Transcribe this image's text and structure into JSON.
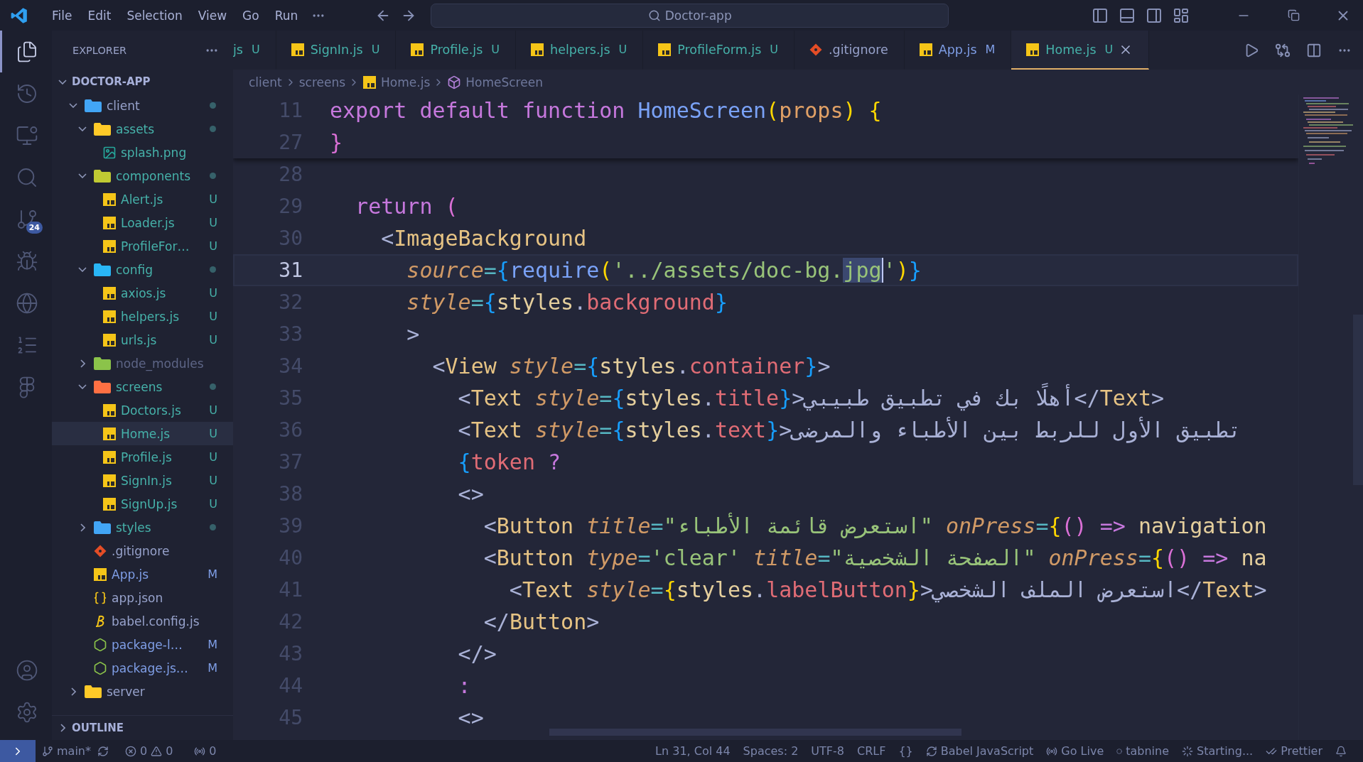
{
  "title_bar": {
    "menus": [
      "File",
      "Edit",
      "Selection",
      "View",
      "Go",
      "Run"
    ],
    "search": "Doctor-app"
  },
  "activity_bar": {
    "items": [
      {
        "kind": "explorer",
        "selected": true
      },
      {
        "kind": "history",
        "selected": false
      },
      {
        "kind": "remote",
        "selected": false
      },
      {
        "kind": "search",
        "selected": false
      },
      {
        "kind": "scm",
        "selected": false,
        "badge": "24"
      },
      {
        "kind": "debug",
        "selected": false
      },
      {
        "kind": "browser",
        "selected": false
      },
      {
        "kind": "list",
        "selected": false
      },
      {
        "kind": "design",
        "selected": false
      }
    ],
    "bottom": [
      {
        "kind": "account"
      },
      {
        "kind": "settings"
      }
    ]
  },
  "sidebar": {
    "title": "EXPLORER",
    "root": {
      "name": "DOCTOR-APP",
      "expanded": true,
      "children": [
        {
          "name": "client",
          "kind": "folder",
          "color": "#42a5f5",
          "expanded": true,
          "modified": true,
          "selected": false,
          "untracked": false,
          "changed": false,
          "ignored": false,
          "children": [
            {
              "name": "assets",
              "kind": "folder",
              "color": "#ffca28",
              "expanded": true,
              "modified": true,
              "selected": false,
              "untracked": true,
              "changed": false,
              "ignored": false,
              "children": [
                {
                  "name": "splash.png",
                  "kind": "image",
                  "selected": false,
                  "untracked": true,
                  "changed": false,
                  "ignored": false
                }
              ]
            },
            {
              "name": "components",
              "kind": "folder",
              "color": "#c0ca33",
              "expanded": true,
              "modified": true,
              "selected": false,
              "untracked": true,
              "changed": false,
              "ignored": false,
              "children": [
                {
                  "name": "Alert.js",
                  "kind": "js",
                  "selected": false,
                  "untracked": true,
                  "changed": false,
                  "ignored": false,
                  "badge": "U"
                },
                {
                  "name": "Loader.js",
                  "kind": "js",
                  "selected": false,
                  "untracked": true,
                  "changed": false,
                  "ignored": false,
                  "badge": "U"
                },
                {
                  "name": "ProfileFor…",
                  "kind": "js",
                  "selected": false,
                  "untracked": true,
                  "changed": false,
                  "ignored": false,
                  "badge": "U"
                }
              ]
            },
            {
              "name": "config",
              "kind": "folder",
              "color": "#29b6f6",
              "expanded": true,
              "modified": true,
              "selected": false,
              "untracked": true,
              "changed": false,
              "ignored": false,
              "children": [
                {
                  "name": "axios.js",
                  "kind": "js",
                  "selected": false,
                  "untracked": true,
                  "changed": false,
                  "ignored": false,
                  "badge": "U"
                },
                {
                  "name": "helpers.js",
                  "kind": "js",
                  "selected": false,
                  "untracked": true,
                  "changed": false,
                  "ignored": false,
                  "badge": "U"
                },
                {
                  "name": "urls.js",
                  "kind": "js",
                  "selected": false,
                  "untracked": true,
                  "changed": false,
                  "ignored": false,
                  "badge": "U"
                }
              ]
            },
            {
              "name": "node_modules",
              "kind": "folder",
              "color": "#8bc34a",
              "expanded": false,
              "modified": false,
              "selected": false,
              "untracked": false,
              "changed": false,
              "ignored": true
            },
            {
              "name": "screens",
              "kind": "folder",
              "color": "#ff7043",
              "expanded": true,
              "modified": true,
              "selected": false,
              "untracked": true,
              "changed": false,
              "ignored": false,
              "children": [
                {
                  "name": "Doctors.js",
                  "kind": "js",
                  "selected": false,
                  "untracked": true,
                  "changed": false,
                  "ignored": false,
                  "badge": "U"
                },
                {
                  "name": "Home.js",
                  "kind": "js",
                  "selected": true,
                  "untracked": true,
                  "changed": false,
                  "ignored": false,
                  "badge": "U"
                },
                {
                  "name": "Profile.js",
                  "kind": "js",
                  "selected": false,
                  "untracked": true,
                  "changed": false,
                  "ignored": false,
                  "badge": "U"
                },
                {
                  "name": "SignIn.js",
                  "kind": "js",
                  "selected": false,
                  "untracked": true,
                  "changed": false,
                  "ignored": false,
                  "badge": "U"
                },
                {
                  "name": "SignUp.js",
                  "kind": "js",
                  "selected": false,
                  "untracked": true,
                  "changed": false,
                  "ignored": false,
                  "badge": "U"
                }
              ]
            },
            {
              "name": "styles",
              "kind": "folder",
              "color": "#42a5f5",
              "expanded": false,
              "modified": true,
              "selected": false,
              "untracked": true,
              "changed": false,
              "ignored": false
            },
            {
              "name": ".gitignore",
              "kind": "git",
              "selected": false,
              "untracked": false,
              "changed": false,
              "ignored": false
            },
            {
              "name": "App.js",
              "kind": "js",
              "selected": false,
              "untracked": false,
              "changed": true,
              "ignored": false,
              "badge": "M"
            },
            {
              "name": "app.json",
              "kind": "json",
              "selected": false,
              "untracked": false,
              "changed": false,
              "ignored": false
            },
            {
              "name": "babel.config.js",
              "kind": "babel",
              "selected": false,
              "untracked": false,
              "changed": false,
              "ignored": false
            },
            {
              "name": "package-l…",
              "kind": "npm",
              "selected": false,
              "untracked": false,
              "changed": true,
              "ignored": false,
              "badge": "M"
            },
            {
              "name": "package.js…",
              "kind": "npm",
              "selected": false,
              "untracked": false,
              "changed": true,
              "ignored": false,
              "badge": "M"
            }
          ]
        },
        {
          "name": "server",
          "kind": "folder",
          "color": "#ffca28",
          "expanded": false,
          "modified": false,
          "selected": false,
          "untracked": false,
          "changed": false,
          "ignored": false
        }
      ]
    },
    "outline": {
      "name": "OUTLINE",
      "expanded": false
    }
  },
  "tabs": [
    {
      "label": "js",
      "untracked": true,
      "changed": false,
      "ignored": false,
      "badge": "U",
      "selected": false
    },
    {
      "label": "SignIn.js",
      "kind": "js",
      "untracked": true,
      "changed": false,
      "ignored": false,
      "badge": "U",
      "selected": false
    },
    {
      "label": "Profile.js",
      "kind": "js",
      "untracked": true,
      "changed": false,
      "ignored": false,
      "badge": "U",
      "selected": false
    },
    {
      "label": "helpers.js",
      "kind": "js",
      "untracked": true,
      "changed": false,
      "ignored": false,
      "badge": "U",
      "selected": false
    },
    {
      "label": "ProfileForm.js",
      "kind": "js",
      "untracked": true,
      "changed": false,
      "ignored": false,
      "badge": "U",
      "selected": false
    },
    {
      "label": ".gitignore",
      "kind": "git",
      "untracked": false,
      "changed": false,
      "ignored": false,
      "selected": false
    },
    {
      "label": "App.js",
      "kind": "js",
      "untracked": false,
      "changed": true,
      "ignored": false,
      "badge": "M",
      "selected": false
    },
    {
      "label": "Home.js",
      "kind": "js",
      "untracked": true,
      "changed": false,
      "ignored": false,
      "badge": "U",
      "selected": true
    }
  ],
  "breadcrumbs": [
    {
      "label": "client",
      "kind": "folder"
    },
    {
      "label": "screens",
      "kind": "folder"
    },
    {
      "label": "Home.js",
      "kind": "js"
    },
    {
      "label": "HomeScreen",
      "kind": "symbol"
    }
  ],
  "editor": {
    "sticky_lines": [
      {
        "number": "11",
        "current": false,
        "tokens": [
          {
            "kind": "kw",
            "text": "export default function "
          },
          {
            "kind": "fn",
            "text": "HomeScreen"
          },
          {
            "kind": "b1",
            "text": "("
          },
          {
            "kind": "param",
            "text": "props"
          },
          {
            "kind": "b1",
            "text": ") {"
          }
        ]
      },
      {
        "number": "27",
        "current": false,
        "tokens": [
          {
            "kind": "b2",
            "text": "}"
          }
        ]
      }
    ],
    "lines": [
      {
        "number": "28",
        "current": false
      },
      {
        "number": "29",
        "current": false,
        "tokens": [
          {
            "kind": "kw",
            "text": "  return "
          },
          {
            "kind": "b2",
            "text": "("
          }
        ]
      },
      {
        "number": "30",
        "current": false,
        "tokens": [
          {
            "kind": "punct",
            "text": "    <"
          },
          {
            "kind": "tag",
            "text": "ImageBackground"
          }
        ]
      },
      {
        "number": "31",
        "current": true,
        "tokens": [
          {
            "kind": "attr",
            "text": "      source"
          },
          {
            "kind": "op",
            "text": "="
          },
          {
            "kind": "b3",
            "text": "{"
          },
          {
            "kind": "fn",
            "text": "require"
          },
          {
            "kind": "b1",
            "text": "("
          },
          {
            "kind": "str",
            "text": "'../assets/doc-bg."
          },
          {
            "kind": "sel",
            "text": "jpg"
          },
          {
            "kind": "str",
            "text": "'"
          },
          {
            "kind": "b1",
            "text": ")"
          },
          {
            "kind": "b3",
            "text": "}"
          }
        ]
      },
      {
        "number": "32",
        "current": false,
        "tokens": [
          {
            "kind": "attr",
            "text": "      style"
          },
          {
            "kind": "op",
            "text": "="
          },
          {
            "kind": "b3",
            "text": "{"
          },
          {
            "kind": "var",
            "text": "styles"
          },
          {
            "kind": "punct",
            "text": "."
          },
          {
            "kind": "prop",
            "text": "background"
          },
          {
            "kind": "b3",
            "text": "}"
          }
        ]
      },
      {
        "number": "33",
        "current": false,
        "tokens": [
          {
            "kind": "punct",
            "text": "      >"
          }
        ]
      },
      {
        "number": "34",
        "current": false,
        "tokens": [
          {
            "kind": "punct",
            "text": "        <"
          },
          {
            "kind": "tag",
            "text": "View"
          },
          {
            "kind": "attr",
            "text": " style"
          },
          {
            "kind": "op",
            "text": "="
          },
          {
            "kind": "b3",
            "text": "{"
          },
          {
            "kind": "var",
            "text": "styles"
          },
          {
            "kind": "punct",
            "text": "."
          },
          {
            "kind": "prop",
            "text": "container"
          },
          {
            "kind": "b3",
            "text": "}"
          },
          {
            "kind": "punct",
            "text": ">"
          }
        ]
      },
      {
        "number": "35",
        "current": false,
        "tokens": [
          {
            "kind": "punct",
            "text": "          <"
          },
          {
            "kind": "tag",
            "text": "Text"
          },
          {
            "kind": "attr",
            "text": " style"
          },
          {
            "kind": "op",
            "text": "="
          },
          {
            "kind": "b3",
            "text": "{"
          },
          {
            "kind": "var",
            "text": "styles"
          },
          {
            "kind": "punct",
            "text": "."
          },
          {
            "kind": "prop",
            "text": "title"
          },
          {
            "kind": "b3",
            "text": "}"
          },
          {
            "kind": "punct",
            "text": ">"
          },
          {
            "kind": "rtl",
            "text": "أهلًا بك في تطبيق طبيبي"
          },
          {
            "kind": "punct",
            "text": "</"
          },
          {
            "kind": "tag",
            "text": "Text"
          },
          {
            "kind": "punct",
            "text": ">"
          }
        ]
      },
      {
        "number": "36",
        "current": false,
        "tokens": [
          {
            "kind": "punct",
            "text": "          <"
          },
          {
            "kind": "tag",
            "text": "Text"
          },
          {
            "kind": "attr",
            "text": " style"
          },
          {
            "kind": "op",
            "text": "="
          },
          {
            "kind": "b3",
            "text": "{"
          },
          {
            "kind": "var",
            "text": "styles"
          },
          {
            "kind": "punct",
            "text": "."
          },
          {
            "kind": "prop",
            "text": "text"
          },
          {
            "kind": "b3",
            "text": "}"
          },
          {
            "kind": "punct",
            "text": ">"
          },
          {
            "kind": "rtl",
            "text": "تطبيق الأول للربط بين الأطباء والمرضى"
          }
        ]
      },
      {
        "number": "37",
        "current": false,
        "tokens": [
          {
            "kind": "b3",
            "text": "          {"
          },
          {
            "kind": "prop",
            "text": "token"
          },
          {
            "kind": "kw",
            "text": " ?"
          }
        ]
      },
      {
        "number": "38",
        "current": false,
        "tokens": [
          {
            "kind": "punct",
            "text": "          <>"
          }
        ]
      },
      {
        "number": "39",
        "current": false,
        "tokens": [
          {
            "kind": "punct",
            "text": "            <"
          },
          {
            "kind": "tag",
            "text": "Button"
          },
          {
            "kind": "attr",
            "text": " title"
          },
          {
            "kind": "op",
            "text": "="
          },
          {
            "kind": "str",
            "text": "\""
          },
          {
            "kind": "str_rtl",
            "text": "استعرض قائمة الأطباء"
          },
          {
            "kind": "str",
            "text": "\""
          },
          {
            "kind": "attr",
            "text": " onPress"
          },
          {
            "kind": "op",
            "text": "="
          },
          {
            "kind": "b1",
            "text": "{"
          },
          {
            "kind": "b2",
            "text": "()"
          },
          {
            "kind": "kw",
            "text": " =>"
          },
          {
            "kind": "var",
            "text": " navigation"
          }
        ]
      },
      {
        "number": "40",
        "current": false,
        "tokens": [
          {
            "kind": "punct",
            "text": "            <"
          },
          {
            "kind": "tag",
            "text": "Button"
          },
          {
            "kind": "attr",
            "text": " type"
          },
          {
            "kind": "op",
            "text": "="
          },
          {
            "kind": "str",
            "text": "'clear'"
          },
          {
            "kind": "attr",
            "text": " title"
          },
          {
            "kind": "op",
            "text": "="
          },
          {
            "kind": "str",
            "text": "\""
          },
          {
            "kind": "str_rtl",
            "text": "الصفحة الشخصية"
          },
          {
            "kind": "str",
            "text": "\""
          },
          {
            "kind": "attr",
            "text": " onPress"
          },
          {
            "kind": "op",
            "text": "="
          },
          {
            "kind": "b1",
            "text": "{"
          },
          {
            "kind": "b2",
            "text": "()"
          },
          {
            "kind": "kw",
            "text": " =>"
          },
          {
            "kind": "var",
            "text": " na"
          }
        ]
      },
      {
        "number": "41",
        "current": false,
        "tokens": [
          {
            "kind": "punct",
            "text": "              <"
          },
          {
            "kind": "tag",
            "text": "Text"
          },
          {
            "kind": "attr",
            "text": " style"
          },
          {
            "kind": "op",
            "text": "="
          },
          {
            "kind": "b1",
            "text": "{"
          },
          {
            "kind": "var",
            "text": "styles"
          },
          {
            "kind": "punct",
            "text": "."
          },
          {
            "kind": "prop",
            "text": "labelButton"
          },
          {
            "kind": "b1",
            "text": "}"
          },
          {
            "kind": "punct",
            "text": ">"
          },
          {
            "kind": "rtl",
            "text": "استعرض الملف الشخصي"
          },
          {
            "kind": "punct",
            "text": "</"
          },
          {
            "kind": "tag",
            "text": "Text"
          },
          {
            "kind": "punct",
            "text": ">"
          }
        ]
      },
      {
        "number": "42",
        "current": false,
        "tokens": [
          {
            "kind": "punct",
            "text": "            </"
          },
          {
            "kind": "tag",
            "text": "Button"
          },
          {
            "kind": "punct",
            "text": ">"
          }
        ]
      },
      {
        "number": "43",
        "current": false,
        "tokens": [
          {
            "kind": "punct",
            "text": "          </>"
          }
        ]
      },
      {
        "number": "44",
        "current": false,
        "tokens": [
          {
            "kind": "kw",
            "text": "          :"
          }
        ]
      },
      {
        "number": "45",
        "current": false,
        "tokens": [
          {
            "kind": "punct",
            "text": "          <>"
          }
        ]
      }
    ]
  },
  "status_bar": {
    "branch": "main*",
    "errors": "0",
    "warnings": "0",
    "ports": "0",
    "right": [
      {
        "kind": "text",
        "text": "Ln 31, Col 44"
      },
      {
        "kind": "text",
        "text": "Spaces: 2"
      },
      {
        "kind": "text",
        "text": "UTF-8"
      },
      {
        "kind": "text",
        "text": "CRLF"
      },
      {
        "kind": "braces",
        "text": "{}"
      },
      {
        "kind": "sync",
        "text": "Babel JavaScript"
      },
      {
        "kind": "live",
        "text": "Go Live"
      },
      {
        "kind": "tabnine",
        "text": "tabnine"
      },
      {
        "kind": "spinner",
        "text": "Starting..."
      },
      {
        "kind": "check",
        "text": "Prettier"
      },
      {
        "kind": "bell"
      }
    ]
  }
}
